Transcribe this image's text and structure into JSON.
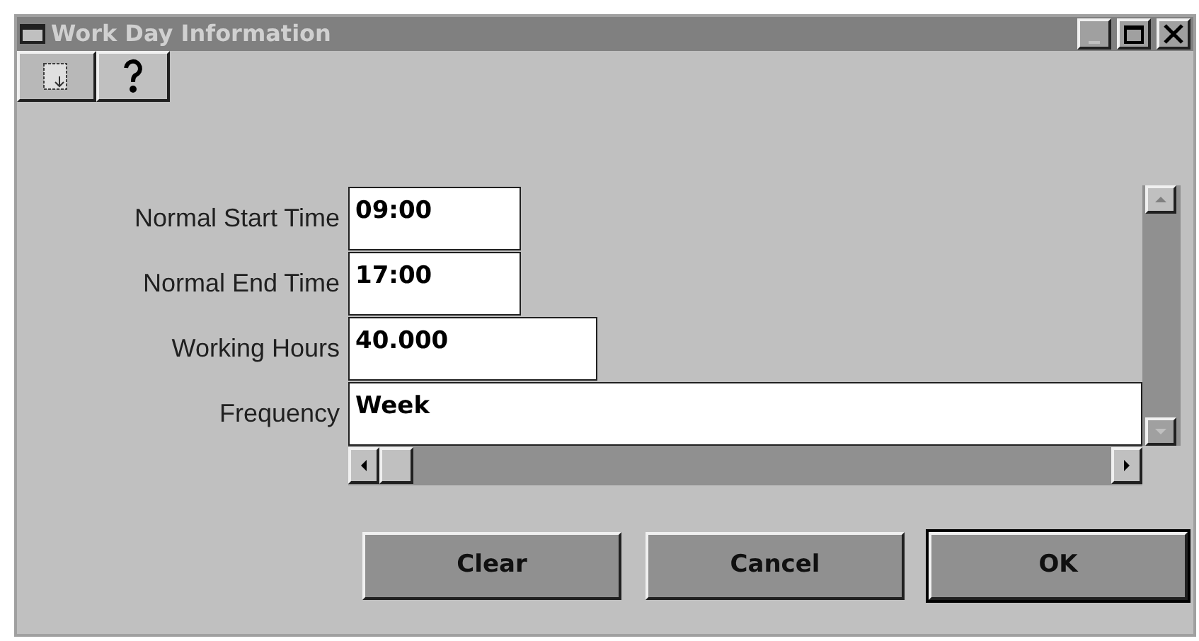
{
  "window": {
    "title": "Work Day Information"
  },
  "fields": [
    {
      "label": "Normal Start Time",
      "value": "09:00"
    },
    {
      "label": "Normal End Time",
      "value": "17:00"
    },
    {
      "label": "Working Hours",
      "value": "40.000"
    },
    {
      "label": "Frequency",
      "value": "Week"
    }
  ],
  "buttons": [
    {
      "label": "Clear",
      "default": false
    },
    {
      "label": "Cancel",
      "default": false
    },
    {
      "label": "OK",
      "default": true
    }
  ]
}
